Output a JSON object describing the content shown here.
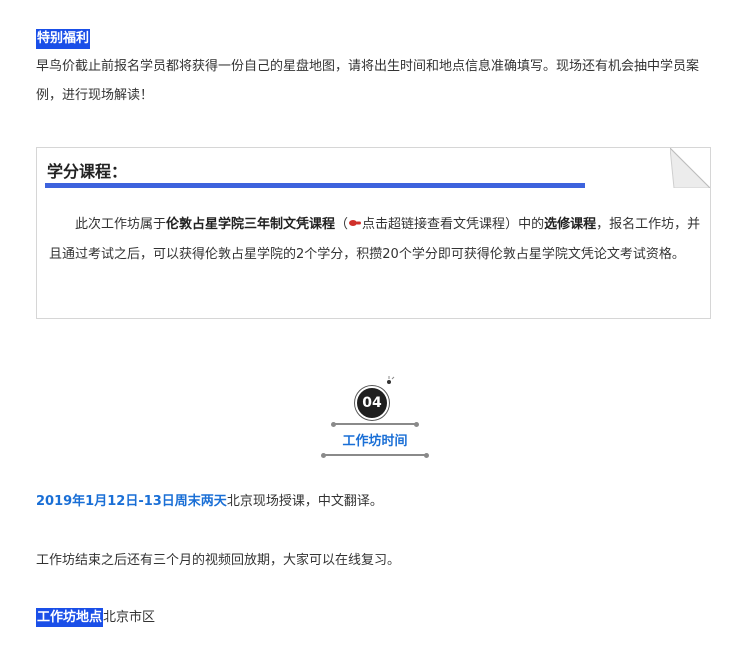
{
  "benefit": {
    "tag": "特别福利",
    "text": "早鸟价截止前报名学员都将获得一份自己的星盘地图，请将出生时间和地点信息准确填写。现场还有机会抽中学员案例，进行现场解读！"
  },
  "credit": {
    "title": "学分课程：",
    "body_prefix": "此次工作坊属于",
    "course_link": "伦敦占星学院三年制文凭课程",
    "paren_open": "（",
    "hint": "点击超链接查看文凭课程",
    "paren_close": "）中的",
    "elective": "选修课程",
    "body_suffix": "，报名工作坊，并且通过考试之后，可以获得伦敦占星学院的2个学分，积攒20个学分即可获得伦敦占星学院文凭论文考试资格。"
  },
  "section": {
    "number": "04",
    "title": "工作坊时间"
  },
  "schedule": {
    "date": "2019年1月12日-13日周末两天",
    "date_suffix": "北京现场授课，中文翻译。",
    "replay": "工作坊结束之后还有三个月的视频回放期，大家可以在线复习。"
  },
  "location": {
    "tag": "工作坊地点",
    "value": "北京市区"
  },
  "colors": {
    "highlight": "#1a4fe8",
    "accent_blue": "#1a6fd6",
    "bar_blue": "#3d63dd"
  }
}
